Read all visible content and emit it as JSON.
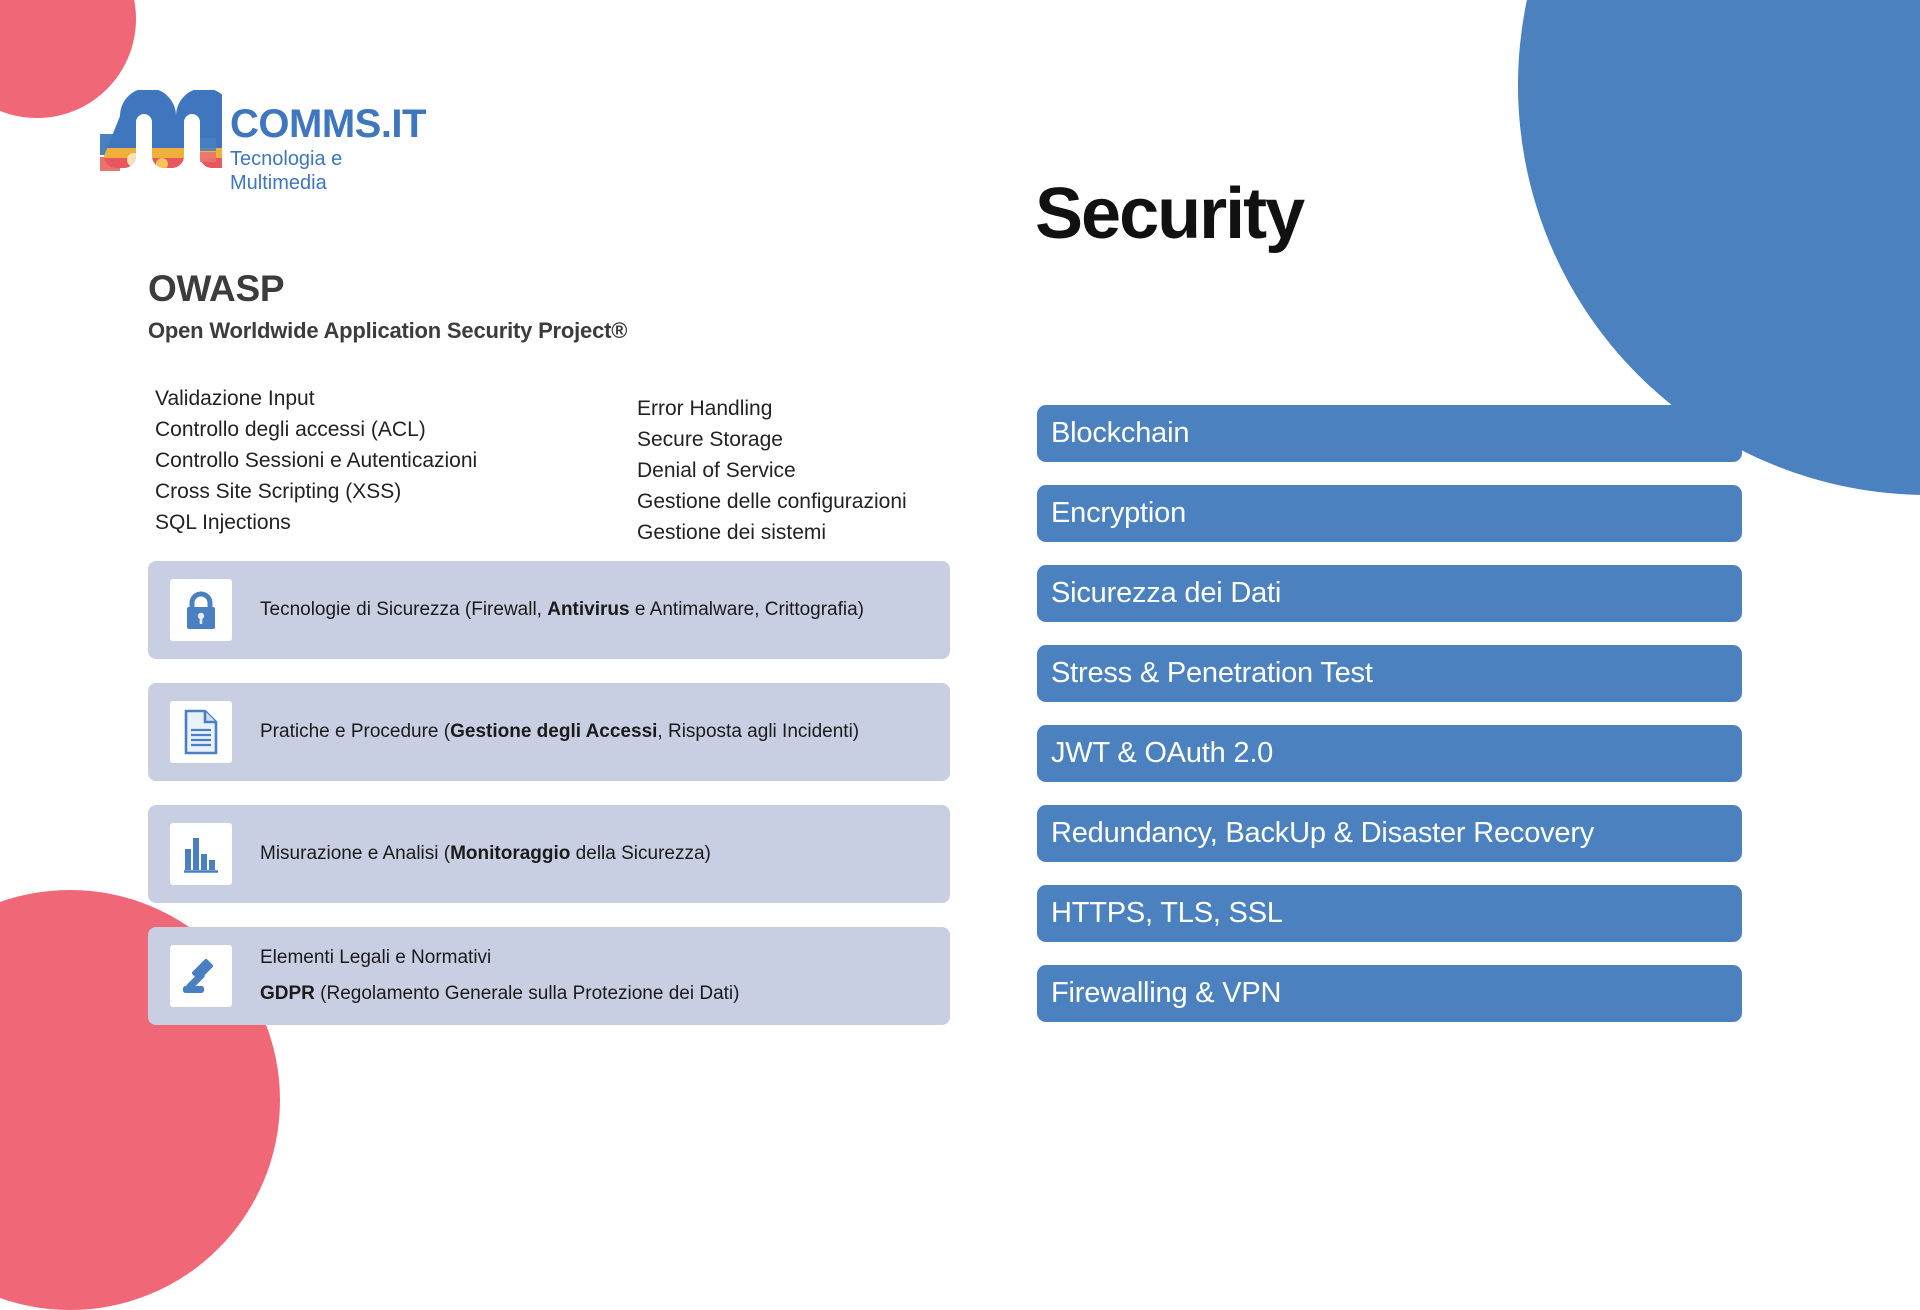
{
  "brand": {
    "wordmark": "COMMS.IT",
    "tagline": "Tecnologia e Multimedia",
    "logo_blue": "#3f76bd"
  },
  "owasp": {
    "title": "OWASP",
    "subtitle": "Open Worldwide Application Security Project®",
    "topics_left": [
      "Validazione Input",
      "Controllo degli accessi (ACL)",
      "Controllo Sessioni e Autenticazioni",
      "Cross Site Scripting (XSS)",
      "SQL Injections"
    ],
    "topics_right": [
      "Error Handling",
      "Secure Storage",
      "Denial of Service",
      "Gestione delle configurazioni",
      "Gestione dei sistemi"
    ]
  },
  "cards": [
    {
      "icon": "padlock-icon",
      "line1_pre": "Tecnologie di Sicurezza (Firewall, ",
      "line1_bold": "Antivirus",
      "line1_post": " e Antimalware, Crittografia)",
      "line2_pre": "",
      "line2_bold": "",
      "line2_post": ""
    },
    {
      "icon": "document-icon",
      "line1_pre": "Pratiche e Procedure (",
      "line1_bold": "Gestione degli Accessi",
      "line1_post": ", Risposta agli Incidenti)",
      "line2_pre": "",
      "line2_bold": "",
      "line2_post": ""
    },
    {
      "icon": "bar-chart-icon",
      "line1_pre": "Misurazione e Analisi (",
      "line1_bold": "Monitoraggio",
      "line1_post": " della Sicurezza)",
      "line2_pre": "",
      "line2_bold": "",
      "line2_post": ""
    },
    {
      "icon": "gavel-icon",
      "line1_pre": "Elementi Legali e Normativi",
      "line1_bold": "",
      "line1_post": "",
      "line2_pre": "",
      "line2_bold": "GDPR",
      "line2_post": " (Regolamento Generale sulla Protezione dei Dati)"
    }
  ],
  "security": {
    "heading": "Security",
    "bar_color": "#4c81bf",
    "bars": [
      "Blockchain",
      "Encryption",
      "Sicurezza dei Dati",
      "Stress & Penetration Test",
      "JWT & OAuth 2.0",
      "Redundancy, BackUp & Disaster Recovery",
      "HTTPS, TLS, SSL",
      "Firewalling & VPN"
    ]
  },
  "decor": {
    "pink": "#f06878",
    "blue": "#4c81bf",
    "card_bg": "#c8cfe2"
  }
}
